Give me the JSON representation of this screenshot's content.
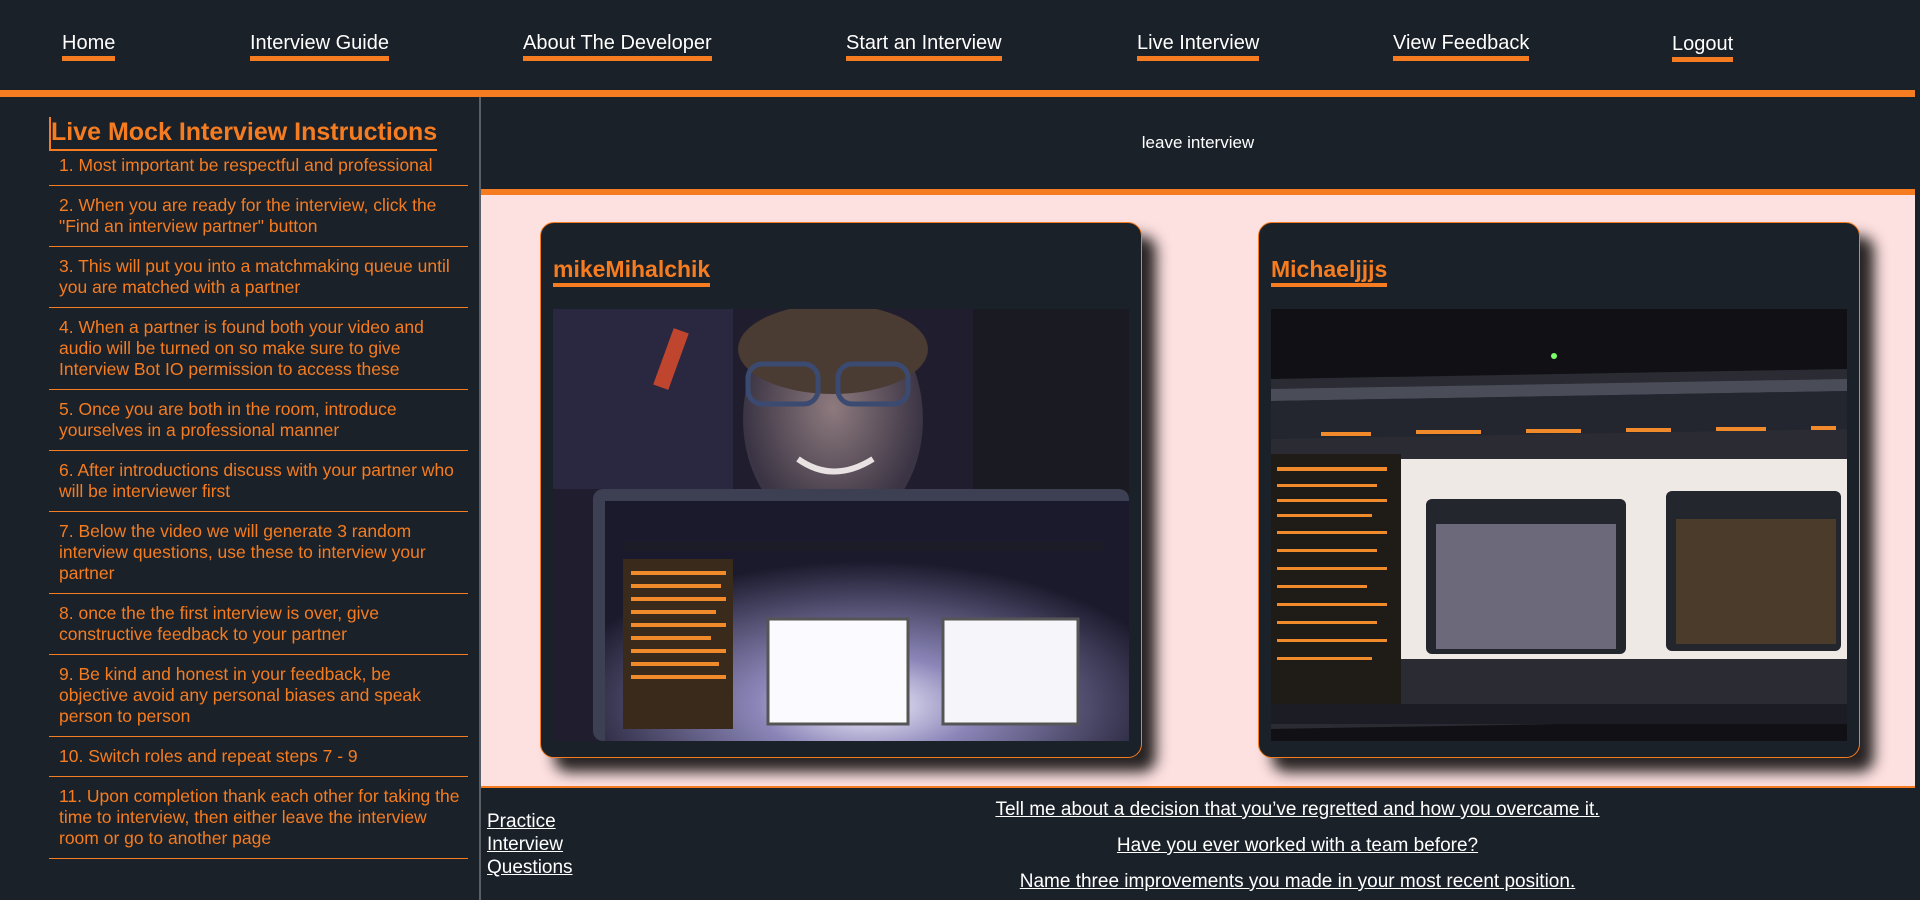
{
  "nav": {
    "items": [
      {
        "label": "Home"
      },
      {
        "label": "Interview Guide"
      },
      {
        "label": "About The Developer"
      },
      {
        "label": "Start an Interview"
      },
      {
        "label": "Live Interview"
      },
      {
        "label": "View Feedback"
      },
      {
        "label": "Logout"
      }
    ],
    "accent_color": "#f57c20"
  },
  "sidebar": {
    "title": "Live Mock Interview Instructions",
    "items": [
      "1. Most important be respectful and professional",
      "2. When you are ready for the interview, click the \"Find an interview partner\" button",
      "3. This will put you into a matchmaking queue until you are matched with a partner",
      "4. When a partner is found both your video and audio will be turned on so make sure to give Interview Bot IO permission to access these",
      "5. Once you are both in the room, introduce yourselves in a professional manner",
      "6. After introductions discuss with your partner who will be interviewer first",
      "7. Below the video we will generate 3 random interview questions, use these to interview your partner",
      "8. once the the first interview is over, give constructive feedback to your partner",
      "9. Be kind and honest in your feedback, be objective avoid any personal biases and speak person to person",
      "10. Switch roles and repeat steps 7 - 9",
      "11. Upon completion thank each other for taking the time to interview, then either leave the interview room or go to another page"
    ]
  },
  "leave": {
    "label": "leave interview"
  },
  "videos": [
    {
      "name": "mikeMihalchik"
    },
    {
      "name": "Michaeljjjs"
    }
  ],
  "practice": {
    "label": "Practice Interview Questions"
  },
  "questions": [
    "Tell me about a decision that you’ve regretted and how you overcame it.",
    "Have you ever worked with a team before?",
    "Name three improvements you made in your most recent position."
  ],
  "colors": {
    "background": "#1b2129",
    "accent": "#f57c20",
    "stage": "#fde0e0"
  }
}
